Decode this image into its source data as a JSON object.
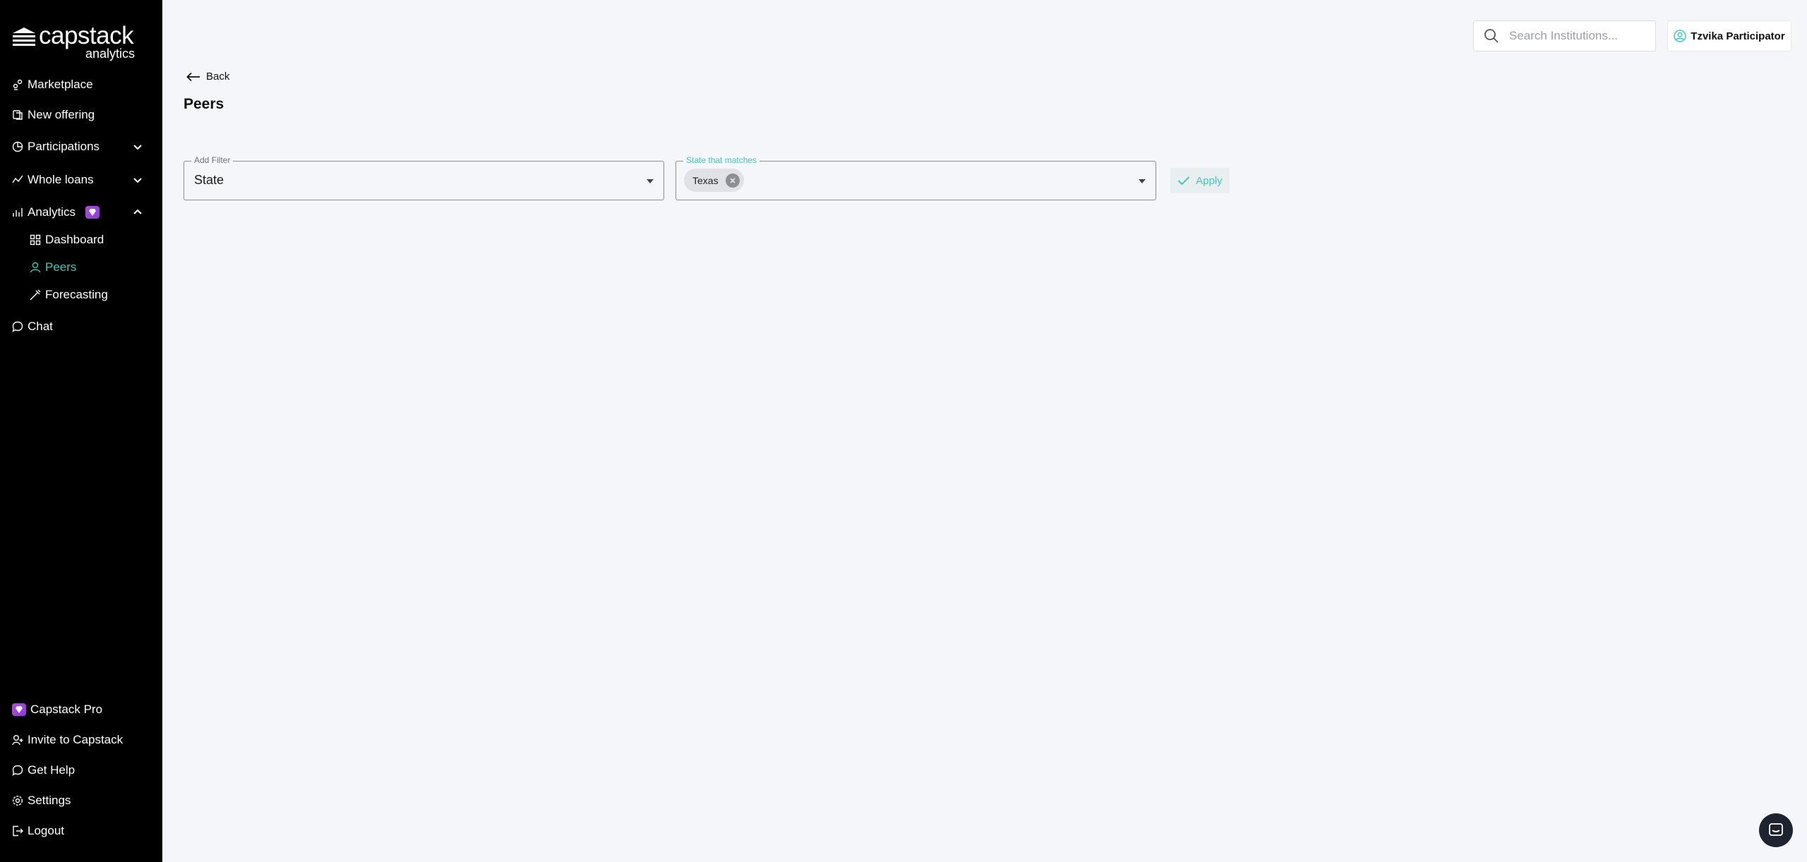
{
  "brand": {
    "name": "capstack",
    "sub": "analytics"
  },
  "sidebar": {
    "items": [
      {
        "label": "Marketplace",
        "icon": "marketplace-icon"
      },
      {
        "label": "New offering",
        "icon": "new-offering-icon"
      },
      {
        "label": "Participations",
        "icon": "participations-icon"
      },
      {
        "label": "Whole loans",
        "icon": "whole-loans-icon"
      },
      {
        "label": "Analytics",
        "icon": "analytics-icon"
      },
      {
        "label": "Dashboard",
        "icon": "dashboard-icon"
      },
      {
        "label": "Peers",
        "icon": "peers-icon",
        "active": true
      },
      {
        "label": "Forecasting",
        "icon": "forecasting-icon"
      },
      {
        "label": "Chat",
        "icon": "chat-icon"
      }
    ],
    "bottom": [
      {
        "label": "Capstack Pro",
        "icon": "pro-gem-icon"
      },
      {
        "label": "Invite to Capstack",
        "icon": "invite-icon"
      },
      {
        "label": "Get Help",
        "icon": "help-icon"
      },
      {
        "label": "Settings",
        "icon": "settings-icon"
      },
      {
        "label": "Logout",
        "icon": "logout-icon"
      }
    ]
  },
  "topbar": {
    "search_placeholder": "Search Institutions...",
    "user_name": "Tzvika Participator"
  },
  "page": {
    "back_label": "Back",
    "title": "Peers"
  },
  "filters": {
    "add_filter_label": "Add Filter",
    "add_filter_value": "State",
    "match_label": "State that matches",
    "match_chips": [
      "Texas"
    ],
    "apply_label": "Apply"
  },
  "colors": {
    "accent": "#3ec9b6",
    "sidebar_bg": "#000000",
    "page_bg": "#f4f6fa",
    "pro": "#9b40dc"
  }
}
